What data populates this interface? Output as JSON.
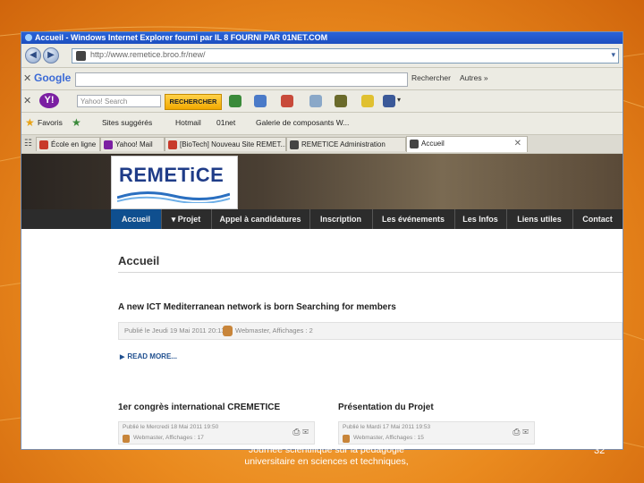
{
  "window": {
    "title": "Accueil - Windows Internet Explorer fourni par IL 8 FOURNI PAR 01NET.COM"
  },
  "address_bar": {
    "url": "http://www.remetice.broo.fr/new/"
  },
  "google_toolbar": {
    "logo": "Google",
    "search_label": "Rechercher",
    "more_label": "Autres »"
  },
  "yahoo_toolbar": {
    "logo": "Y!",
    "search_placeholder": "Yahoo! Search",
    "search_button": "RECHERCHER"
  },
  "favorites_bar": {
    "favorites_label": "Favoris",
    "items": [
      "Sites suggérés",
      "Hotmail",
      "01net",
      "Galerie de composants W..."
    ]
  },
  "tabs": [
    {
      "label": "École en ligne"
    },
    {
      "label": "Yahoo! Mail"
    },
    {
      "label": "[BioTech] Nouveau Site REMET..."
    },
    {
      "label": "REMETICE Administration"
    },
    {
      "label": "Accueil"
    }
  ],
  "site": {
    "logo_text": "REMETiCE",
    "menu": [
      "Accueil",
      "▾ Projet",
      "Appel à candidatures",
      "Inscription",
      "Les événements",
      "Les Infos",
      "Liens utiles",
      "Contact"
    ],
    "page_title": "Accueil",
    "article": {
      "title": "A new ICT Mediterranean network is born Searching for members",
      "date": "Publié le Jeudi 19 Mai 2011 20:13",
      "by": "Webmaster, Affichages : 2",
      "read_more": "READ MORE..."
    },
    "sections": [
      {
        "title": "1er congrès international CREMETICE",
        "date": "Publié le Mercredi 18 Mai 2011 19:50",
        "by": "Webmaster, Affichages : 17"
      },
      {
        "title": "Présentation du Projet",
        "date": "Publié le Mardi 17 Mai 2011 19:53",
        "by": "Webmaster, Affichages : 15"
      }
    ]
  },
  "slide": {
    "footer_line1": "Journée scientifique sur la pédagogie",
    "footer_line2": "universitaire en sciences et techniques,",
    "page_number": "32"
  },
  "colors": {
    "slide_orange": "#ea8a1e",
    "menu_dark": "#2c2c2c",
    "menu_active": "#0f4f8f",
    "titlebar_blue": "#2a63d8"
  }
}
